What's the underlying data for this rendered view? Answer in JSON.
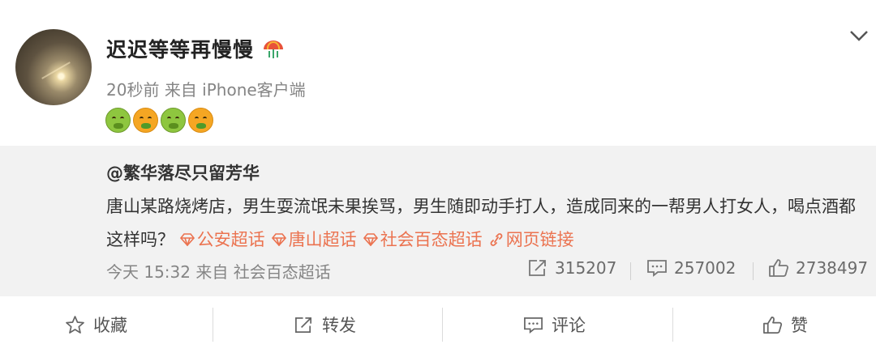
{
  "post": {
    "author": "迟迟等等再慢慢",
    "time": "20秒前",
    "source": "来自 iPhone客户端",
    "emoji_icons": [
      "nauseated-face-icon",
      "vomiting-face-icon",
      "nauseated-face-icon",
      "vomiting-face-icon"
    ]
  },
  "repost": {
    "author": "@繁华落尽只留芳华",
    "text": "唐山某路烧烤店，男生耍流氓未果挨骂，男生随即动手打人，造成同来的一帮男人打女人，喝点酒都这样吗？",
    "topics": [
      "公安超话",
      "唐山超话",
      "社会百态超话"
    ],
    "link_label": "网页链接",
    "time": "今天 15:32",
    "source": "来自 社会百态超话",
    "reposts": "315207",
    "comments": "257002",
    "likes": "2738497"
  },
  "actions": {
    "favorite": "收藏",
    "repost": "转发",
    "comment": "评论",
    "like": "赞"
  },
  "colors": {
    "topic": "#eb7350",
    "repost_bg": "#f2f2f2",
    "meta": "#858585"
  }
}
